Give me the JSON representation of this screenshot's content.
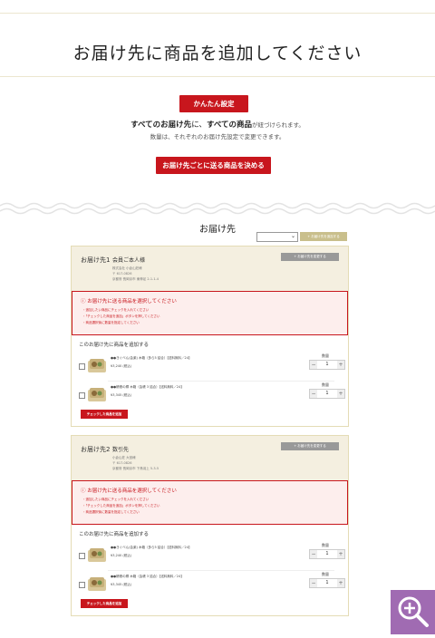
{
  "header": {
    "title": "お届け先に商品を追加してください",
    "easy_button": "かんたん設定",
    "message_line1_a": "すべてのお届け先",
    "message_line1_b": "に、",
    "message_line1_c": "すべての商品",
    "message_line1_d": "が紐づけられます。",
    "message_line2": "数量は、それぞれのお届け先設定で変更できます。",
    "per_dest_button": "お届け先ごとに送る商品を決める"
  },
  "section": {
    "title": "お届け先",
    "select_value": "",
    "add_dest_button": "+ お届け先を追加する"
  },
  "destinations": [
    {
      "label": "お届け先1",
      "name": "会員ご本人様",
      "address": [
        "株式会社 小倉山荘様",
        "〒 617-0826",
        "京都府 長岡京市 東神足 2-1-1-4"
      ],
      "change_button": "+ お届け先を変更する",
      "alert_title": "お届け先に送る商品を選択してください",
      "alert_items": [
        "・追加したい商品にチェックを入れてください",
        "・「チェックした商品を追加」ボタンを押してください",
        "・商品選択後に数量を指定してください"
      ],
      "add_label": "このお届け先に商品を追加する",
      "products": [
        {
          "name": "●●きぐべん(会楽) 木箱（多ら5 詰合）【送料無料／24】",
          "price": "¥3,240 (税込)",
          "qty_label": "数量",
          "qty": "1"
        },
        {
          "name": "●●帳帳の郷 木箱（会帳 3 詰合）【送料無料／24】",
          "price": "¥3,345 (税込)",
          "qty_label": "数量",
          "qty": "1"
        }
      ],
      "add_checked_button": "チェックした商品を追加"
    },
    {
      "label": "お届け先2",
      "name": "数引先",
      "address": [
        "小倉山荘 大宮様",
        "〒 617-0826",
        "京都府 長岡京市 下鳥羽上 5-3-5"
      ],
      "change_button": "+ お届け先を変更する",
      "alert_title": "お届け先に送る商品を選択してください",
      "alert_items": [
        "・追加したい商品にチェックを入れてください",
        "・「チェックした商品を追加」ボタンを押してください",
        "・商品選択後に数量を指定してください"
      ],
      "add_label": "このお届け先に商品を追加する",
      "products": [
        {
          "name": "●●きぐべん(会楽) 木箱（多ら5 詰合）【送料無料／24】",
          "price": "¥3,240 (税込)",
          "qty_label": "数量",
          "qty": "1"
        },
        {
          "name": "●●帳帳の郷 木箱（会帳 3 詰合）【送料無料／24】",
          "price": "¥3,345 (税込)",
          "qty_label": "数量",
          "qty": "1"
        }
      ],
      "add_checked_button": "チェックした商品を追加"
    }
  ],
  "colors": {
    "accent": "#c8161d",
    "beige": "#f4efe0",
    "olive": "#c9bf8c",
    "zoom": "#a06bb2"
  },
  "icons": {
    "zoom": "zoom-in-icon",
    "alert": "alert-circle-icon",
    "chevron": "chevron-down-icon"
  }
}
